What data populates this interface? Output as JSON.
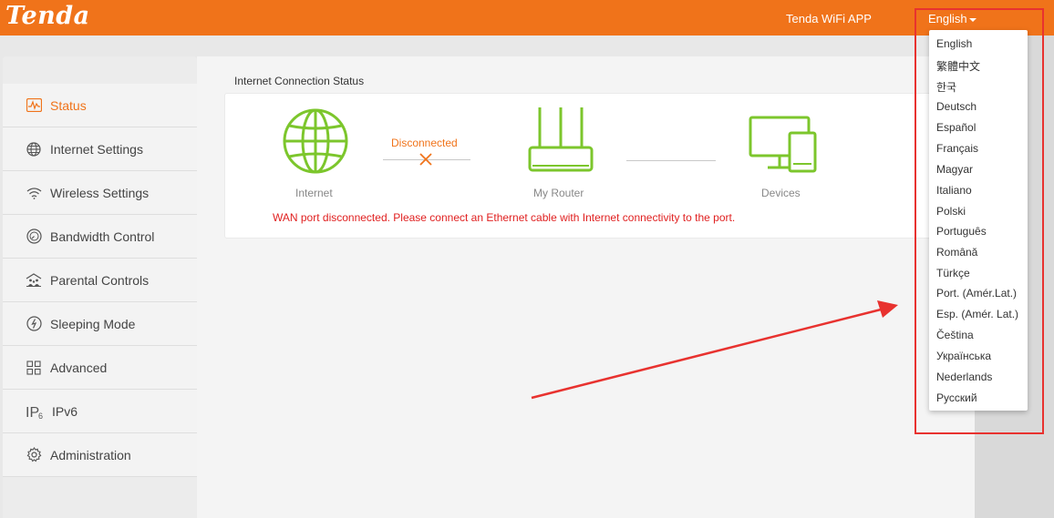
{
  "header": {
    "logo": "Tenda",
    "app_link": "Tenda WiFi APP",
    "language": "English"
  },
  "sidebar": {
    "items": [
      {
        "label": "Status"
      },
      {
        "label": "Internet Settings"
      },
      {
        "label": "Wireless Settings"
      },
      {
        "label": "Bandwidth Control"
      },
      {
        "label": "Parental Controls"
      },
      {
        "label": "Sleeping Mode"
      },
      {
        "label": "Advanced"
      },
      {
        "label": "IPv6"
      },
      {
        "label": "Administration"
      }
    ]
  },
  "main": {
    "section_title": "Internet Connection Status",
    "internet_label": "Internet",
    "router_label": "My Router",
    "devices_label": "Devices",
    "connection_status": "Disconnected",
    "warning": "WAN port disconnected. Please connect an Ethernet cable with Internet connectivity to the port."
  },
  "language_menu": {
    "options": [
      "English",
      "繁體中文",
      "한국",
      "Deutsch",
      "Español",
      "Français",
      "Magyar",
      "Italiano",
      "Polski",
      "Português",
      "Română",
      "Türkçe",
      "Port. (Amér.Lat.)",
      "Esp. (Amér. Lat.)",
      "Čeština",
      "Українська",
      "Nederlands",
      "Русский"
    ]
  },
  "colors": {
    "brand": "#f0731a",
    "device_icon": "#7cc62c",
    "warning": "#e02020",
    "annotation": "#e8322f"
  }
}
